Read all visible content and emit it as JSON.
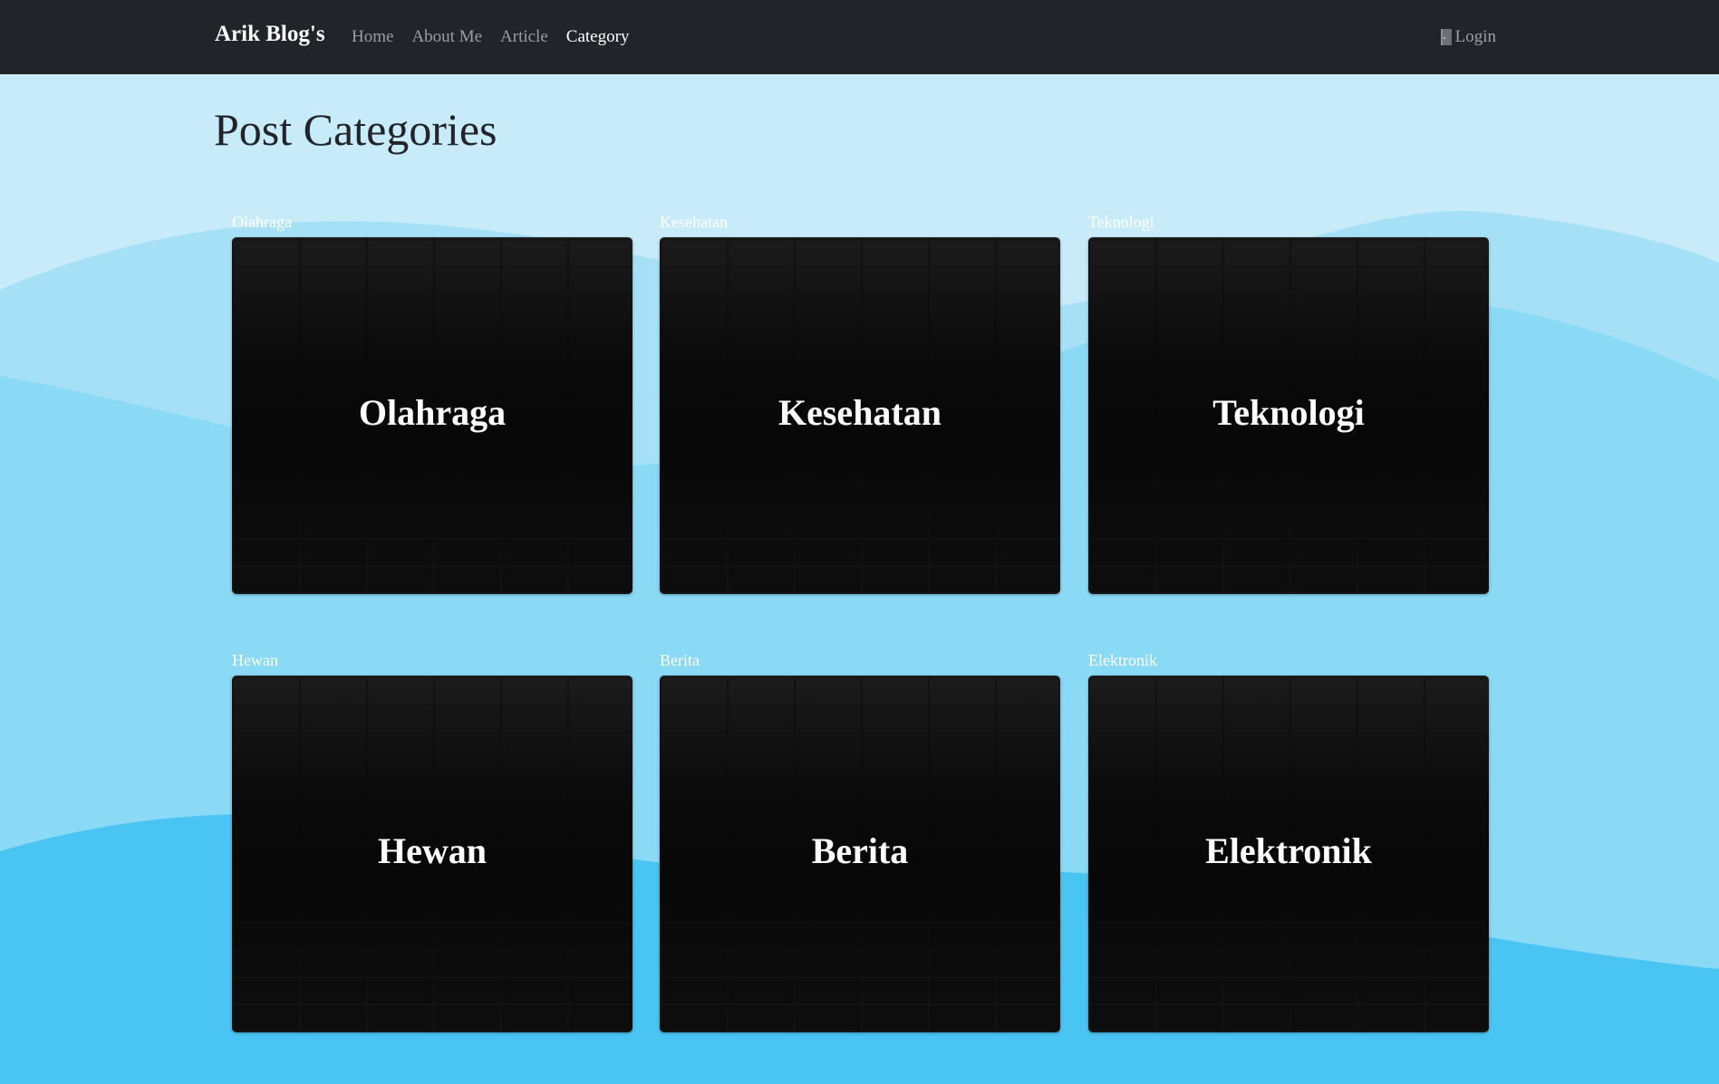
{
  "navbar": {
    "brand": "Arik Blog's",
    "links": [
      "Home",
      "About Me",
      "Article",
      "Category"
    ],
    "active": "Category",
    "login_label": "Login",
    "login_icon": "door-icon"
  },
  "page": {
    "title": "Post Categories"
  },
  "categories": [
    {
      "label": "Olahraga",
      "title": "Olahraga"
    },
    {
      "label": "Kesehatan",
      "title": "Kesehatan"
    },
    {
      "label": "Teknologi",
      "title": "Teknologi"
    },
    {
      "label": "Hewan",
      "title": "Hewan"
    },
    {
      "label": "Berita",
      "title": "Berita"
    },
    {
      "label": "Elektronik",
      "title": "Elektronik"
    }
  ],
  "colors": {
    "navbar_bg": "#212529",
    "page_bg": "#c7ebf9",
    "wave_light": "#a6e0f7",
    "wave_mid": "#8ad9f5",
    "wave_dark": "#4ac4f2"
  }
}
